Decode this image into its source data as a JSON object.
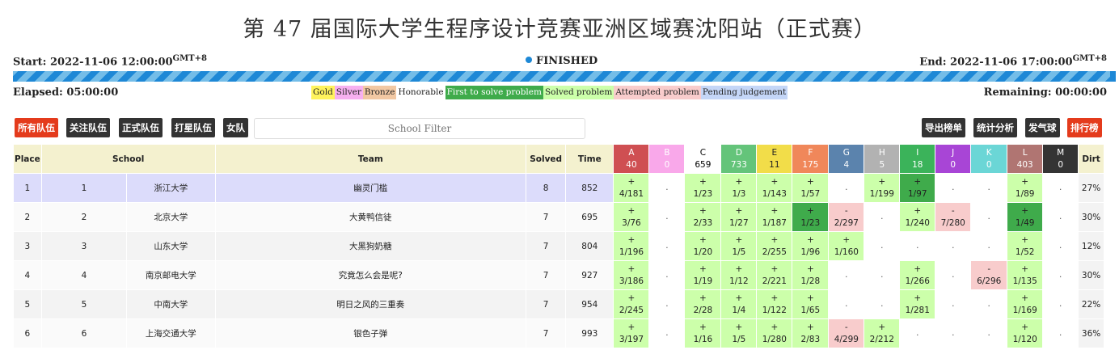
{
  "title": "第 47 届国际大学生程序设计竞赛亚洲区域赛沈阳站（正式赛）",
  "timeline": {
    "start_label": "Start: 2022-11-06 12:00:00",
    "end_label": "End: 2022-11-06 17:00:00",
    "tz": "GMT+8",
    "status": "FINISHED",
    "status_color": "#1e88d6",
    "progress": 1.0,
    "elapsed_label": "Elapsed: 05:00:00",
    "remaining_label": "Remaining: 00:00:00"
  },
  "legend": [
    {
      "label": "Gold",
      "color": "#fff35c"
    },
    {
      "label": "Silver",
      "color": "#f7b0f0"
    },
    {
      "label": "Bronze",
      "color": "#f2c8a3"
    },
    {
      "label": "Honorable",
      "color": "#ffffff"
    },
    {
      "label": "First to solve problem",
      "color": "#3fab4b"
    },
    {
      "label": "Solved problem",
      "color": "#ccffaa"
    },
    {
      "label": "Attempted problem",
      "color": "#f8cccc"
    },
    {
      "label": "Pending judgement",
      "color": "#c4d6f7"
    }
  ],
  "toolbar": {
    "left_buttons": [
      {
        "label": "所有队伍",
        "color": "#e43b1c"
      },
      {
        "label": "关注队伍",
        "color": "#333333"
      },
      {
        "label": "正式队伍",
        "color": "#333333"
      },
      {
        "label": "打星队伍",
        "color": "#333333"
      },
      {
        "label": "女队",
        "color": "#333333"
      }
    ],
    "filter_placeholder": "School Filter",
    "right_buttons": [
      {
        "label": "导出榜单",
        "color": "#333333"
      },
      {
        "label": "统计分析",
        "color": "#333333"
      },
      {
        "label": "发气球",
        "color": "#333333"
      },
      {
        "label": "排行榜",
        "color": "#e43b1c"
      }
    ]
  },
  "table": {
    "headers": {
      "place": "Place",
      "school": "School",
      "team": "Team",
      "solved": "Solved",
      "time": "Time",
      "dirt": "Dirt"
    },
    "problems": [
      {
        "id": "A",
        "count": "40",
        "color": "#cf4f52",
        "text": "#ffffff"
      },
      {
        "id": "B",
        "count": "0",
        "color": "#f9a8ea",
        "text": "#ffffff"
      },
      {
        "id": "C",
        "count": "659",
        "color": "#ffffff",
        "text": "#000000"
      },
      {
        "id": "D",
        "count": "733",
        "color": "#64c47a",
        "text": "#ffffff"
      },
      {
        "id": "E",
        "count": "11",
        "color": "#f2dd49",
        "text": "#222222"
      },
      {
        "id": "F",
        "count": "175",
        "color": "#f0875a",
        "text": "#ffffff"
      },
      {
        "id": "G",
        "count": "4",
        "color": "#5b83ad",
        "text": "#ffffff"
      },
      {
        "id": "H",
        "count": "5",
        "color": "#b2b2b2",
        "text": "#ffffff"
      },
      {
        "id": "I",
        "count": "18",
        "color": "#3bb35a",
        "text": "#ffffff"
      },
      {
        "id": "J",
        "count": "0",
        "color": "#a845d6",
        "text": "#ffffff"
      },
      {
        "id": "K",
        "count": "0",
        "color": "#6bd6d6",
        "text": "#ffffff"
      },
      {
        "id": "L",
        "count": "403",
        "color": "#b07572",
        "text": "#ffffff"
      },
      {
        "id": "M",
        "count": "0",
        "color": "#343434",
        "text": "#ffffff"
      }
    ],
    "rows": [
      {
        "place": "1",
        "org_rank": "1",
        "school": "浙江大学",
        "team": "幽灵门槛",
        "solved": "8",
        "time": "852",
        "dirt": "27%",
        "highlight": true,
        "cells": [
          [
            "s",
            "4/181"
          ],
          [
            "n",
            ""
          ],
          [
            "s",
            "1/23"
          ],
          [
            "s",
            "1/3"
          ],
          [
            "s",
            "1/143"
          ],
          [
            "s",
            "1/57"
          ],
          [
            "n",
            ""
          ],
          [
            "s",
            "1/199"
          ],
          [
            "f",
            "1/97"
          ],
          [
            "n",
            ""
          ],
          [
            "n",
            ""
          ],
          [
            "s",
            "1/89"
          ],
          [
            "n",
            ""
          ]
        ]
      },
      {
        "place": "2",
        "org_rank": "2",
        "school": "北京大学",
        "team": "大黄鸭信徒",
        "solved": "7",
        "time": "695",
        "dirt": "30%",
        "highlight": false,
        "cells": [
          [
            "s",
            "3/76"
          ],
          [
            "n",
            ""
          ],
          [
            "s",
            "2/33"
          ],
          [
            "s",
            "1/27"
          ],
          [
            "s",
            "1/187"
          ],
          [
            "f",
            "1/23"
          ],
          [
            "a",
            "2/297"
          ],
          [
            "n",
            ""
          ],
          [
            "s",
            "1/240"
          ],
          [
            "a",
            "7/280"
          ],
          [
            "n",
            ""
          ],
          [
            "f",
            "1/49"
          ],
          [
            "n",
            ""
          ]
        ]
      },
      {
        "place": "3",
        "org_rank": "3",
        "school": "山东大学",
        "team": "大黑狗奶糖",
        "solved": "7",
        "time": "804",
        "dirt": "12%",
        "highlight": false,
        "cells": [
          [
            "s",
            "1/196"
          ],
          [
            "n",
            ""
          ],
          [
            "s",
            "1/20"
          ],
          [
            "s",
            "1/5"
          ],
          [
            "s",
            "2/255"
          ],
          [
            "s",
            "1/96"
          ],
          [
            "s",
            "1/160"
          ],
          [
            "n",
            ""
          ],
          [
            "n",
            ""
          ],
          [
            "n",
            ""
          ],
          [
            "n",
            ""
          ],
          [
            "s",
            "1/52"
          ],
          [
            "n",
            ""
          ]
        ]
      },
      {
        "place": "4",
        "org_rank": "4",
        "school": "南京邮电大学",
        "team": "究竟怎么会是呢?",
        "solved": "7",
        "time": "927",
        "dirt": "30%",
        "highlight": false,
        "cells": [
          [
            "s",
            "3/186"
          ],
          [
            "n",
            ""
          ],
          [
            "s",
            "1/19"
          ],
          [
            "s",
            "1/12"
          ],
          [
            "s",
            "2/221"
          ],
          [
            "s",
            "1/28"
          ],
          [
            "n",
            ""
          ],
          [
            "n",
            ""
          ],
          [
            "s",
            "1/266"
          ],
          [
            "n",
            ""
          ],
          [
            "a",
            "6/296"
          ],
          [
            "s",
            "1/135"
          ],
          [
            "n",
            ""
          ]
        ]
      },
      {
        "place": "5",
        "org_rank": "5",
        "school": "中南大学",
        "team": "明日之风的三重奏",
        "solved": "7",
        "time": "954",
        "dirt": "22%",
        "highlight": false,
        "cells": [
          [
            "s",
            "2/245"
          ],
          [
            "n",
            ""
          ],
          [
            "s",
            "2/28"
          ],
          [
            "s",
            "1/4"
          ],
          [
            "s",
            "1/122"
          ],
          [
            "s",
            "1/65"
          ],
          [
            "n",
            ""
          ],
          [
            "n",
            ""
          ],
          [
            "s",
            "1/281"
          ],
          [
            "n",
            ""
          ],
          [
            "n",
            ""
          ],
          [
            "s",
            "1/169"
          ],
          [
            "n",
            ""
          ]
        ]
      },
      {
        "place": "6",
        "org_rank": "6",
        "school": "上海交通大学",
        "team": "银色子弹",
        "solved": "7",
        "time": "993",
        "dirt": "36%",
        "highlight": false,
        "cells": [
          [
            "s",
            "3/197"
          ],
          [
            "n",
            ""
          ],
          [
            "s",
            "1/16"
          ],
          [
            "s",
            "1/5"
          ],
          [
            "s",
            "1/280"
          ],
          [
            "s",
            "2/83"
          ],
          [
            "a",
            "4/299"
          ],
          [
            "s",
            "2/212"
          ],
          [
            "n",
            ""
          ],
          [
            "n",
            ""
          ],
          [
            "n",
            ""
          ],
          [
            "s",
            "1/120"
          ],
          [
            "n",
            ""
          ]
        ]
      }
    ]
  }
}
